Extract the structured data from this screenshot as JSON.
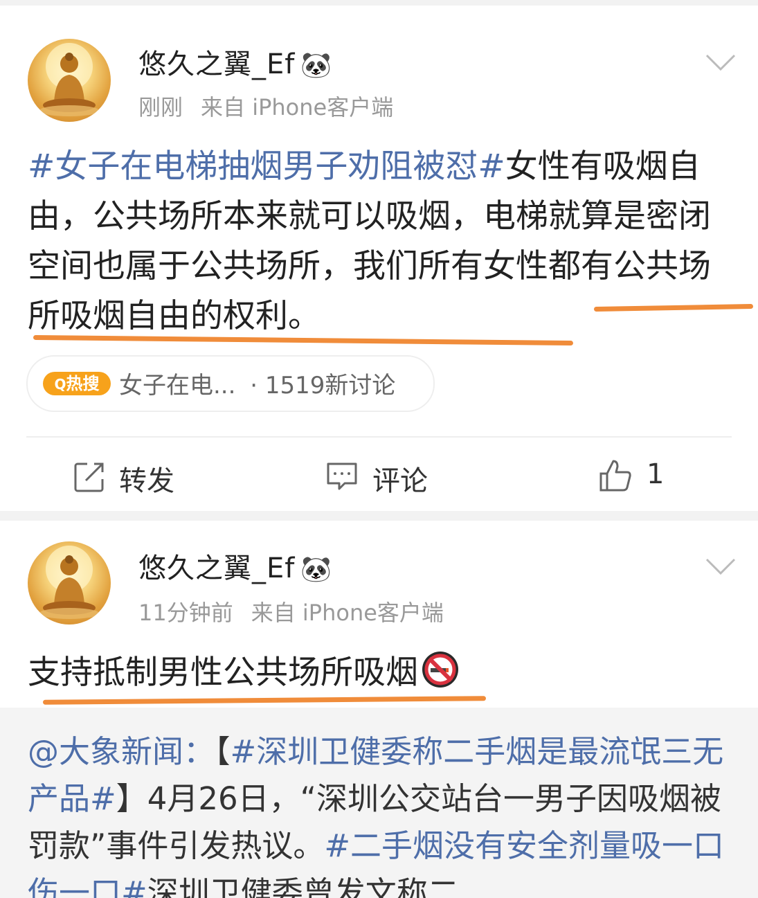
{
  "post1": {
    "username": "悠久之翼_Ef",
    "time": "刚刚",
    "source": "来自 iPhone客户端",
    "hashtag": "#女子在电梯抽烟男子劝阻被怼#",
    "body": "女性有吸烟自由，公共场所本来就可以吸烟，电梯就算是密闭空间也属于公共场所，我们所有女性都有公共场所吸烟自由的权利。",
    "hot_badge": "热搜",
    "hot_topic": "女子在电...",
    "hot_count": "· 1519新讨论",
    "actions": {
      "repost": "转发",
      "comment": "评论",
      "like_count": "1"
    }
  },
  "post2": {
    "username": "悠久之翼_Ef",
    "time": "11分钟前",
    "source": "来自 iPhone客户端",
    "body": "支持抵制男性公共场所吸烟",
    "repost": {
      "mention": "@大象新闻：",
      "bracket_open": "【",
      "hashtag1": "#深圳卫健委称二手烟是最流氓三无产品#",
      "bracket_close": "】",
      "text1": "4月26日，“深圳公交站台一男子因吸烟被罚款”事件引发热议。",
      "hashtag2": "#二手烟没有安全剂量吸一口伤一口#",
      "text2": "深圳卫健委曾发文称二"
    }
  },
  "colors": {
    "hashtag": "#4e6ea9",
    "underline": "#f08c3a",
    "hot_badge": "#f7a21b"
  },
  "icons": [
    "avatar-buddha",
    "panda-icon",
    "chevron-down-icon",
    "hot-search-icon",
    "repost-icon",
    "comment-icon",
    "thumbs-up-icon",
    "no-smoking-icon"
  ]
}
